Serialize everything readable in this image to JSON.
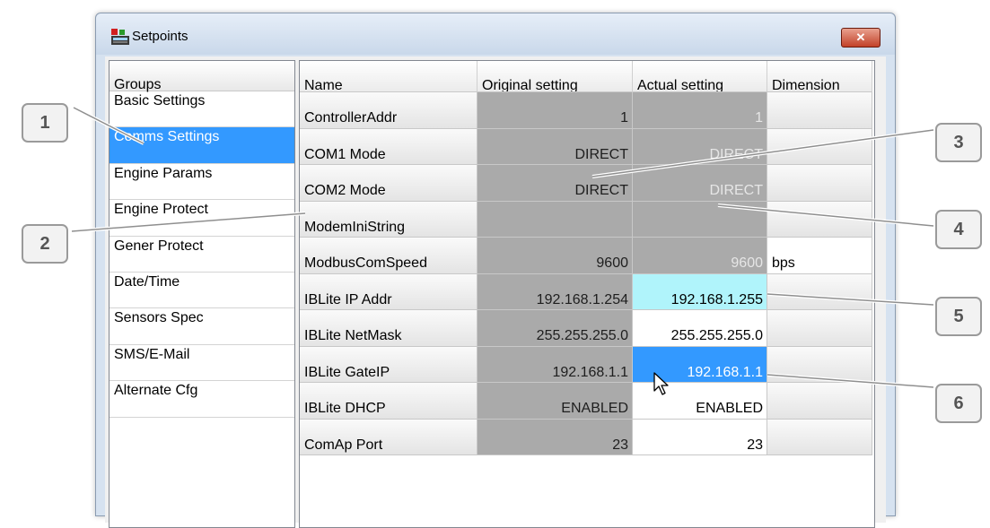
{
  "window": {
    "title": "Setpoints",
    "close_glyph": "✕"
  },
  "groups": {
    "header": "Groups",
    "items": [
      {
        "label": "Basic Settings"
      },
      {
        "label": "Comms Settings",
        "selected": true
      },
      {
        "label": "Engine Params"
      },
      {
        "label": "Engine Protect"
      },
      {
        "label": "Gener Protect"
      },
      {
        "label": "Date/Time"
      },
      {
        "label": "Sensors Spec"
      },
      {
        "label": "SMS/E-Mail"
      },
      {
        "label": "Alternate Cfg"
      }
    ]
  },
  "table": {
    "columns": [
      "Name",
      "Original setting",
      "Actual setting",
      "Dimension"
    ],
    "rows": [
      {
        "name": "ControllerAddr",
        "original": "1",
        "actual": "1",
        "dimension": "",
        "actual_state": "readonly"
      },
      {
        "name": "COM1 Mode",
        "original": "DIRECT",
        "actual": "DIRECT",
        "dimension": "",
        "actual_state": "readonly"
      },
      {
        "name": "COM2 Mode",
        "original": "DIRECT",
        "actual": "DIRECT",
        "dimension": "",
        "actual_state": "readonly"
      },
      {
        "name": "ModemIniString",
        "original": "",
        "actual": "",
        "dimension": "",
        "actual_state": "readonly"
      },
      {
        "name": "ModbusComSpeed",
        "original": "9600",
        "actual": "9600",
        "dimension": "bps",
        "actual_state": "readonly"
      },
      {
        "name": "IBLite IP Addr",
        "original": "192.168.1.254",
        "actual": "192.168.1.255",
        "dimension": "",
        "actual_state": "changed"
      },
      {
        "name": "IBLite NetMask",
        "original": "255.255.255.0",
        "actual": "255.255.255.0",
        "dimension": "",
        "actual_state": "editable"
      },
      {
        "name": "IBLite GateIP",
        "original": "192.168.1.1",
        "actual": "192.168.1.1",
        "dimension": "",
        "actual_state": "selected"
      },
      {
        "name": "IBLite DHCP",
        "original": "ENABLED",
        "actual": "ENABLED",
        "dimension": "",
        "actual_state": "editable"
      },
      {
        "name": "ComAp Port",
        "original": "23",
        "actual": "23",
        "dimension": "",
        "actual_state": "editable"
      }
    ]
  },
  "callouts": [
    "1",
    "2",
    "3",
    "4",
    "5",
    "6"
  ],
  "colors": {
    "selection": "#3399ff",
    "readonly_cell": "#aaaaaa",
    "changed_cell": "#b0f4fb",
    "close_button": "#c24128"
  },
  "icons": {
    "app": "setpoints-app-icon",
    "close": "close-icon",
    "cursor": "mouse-pointer-icon"
  }
}
